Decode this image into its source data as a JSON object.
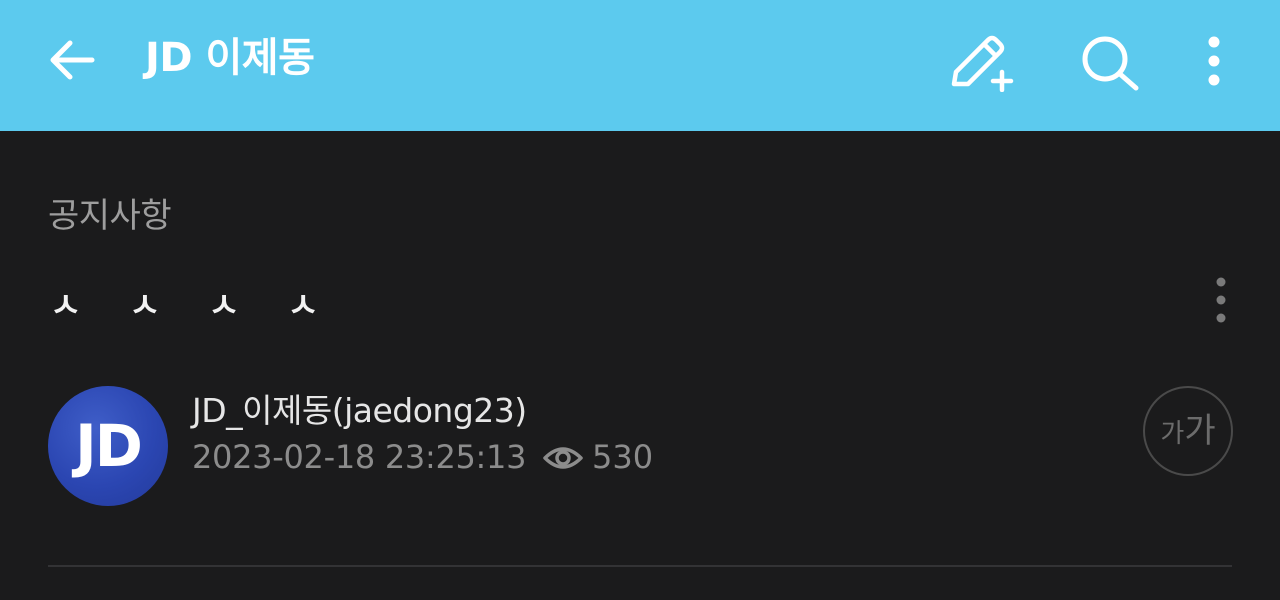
{
  "header": {
    "title": "JD 이제동",
    "back_icon": "arrow-left-icon",
    "actions": [
      "write-post-icon",
      "search-icon",
      "more-vertical-icon"
    ],
    "background_color": "#5ccaee"
  },
  "post": {
    "category": "공지사항",
    "title": "ㅅ ㅅ ㅅ ㅅ",
    "author": "JD_이제동(jaedong23)",
    "avatar_text": "JD",
    "datetime": "2023-02-18 23:25:13",
    "views": "530",
    "views_icon": "eye-icon",
    "menu_icon": "more-vertical-icon"
  },
  "font_size_control": {
    "small": "가",
    "large": "가"
  }
}
